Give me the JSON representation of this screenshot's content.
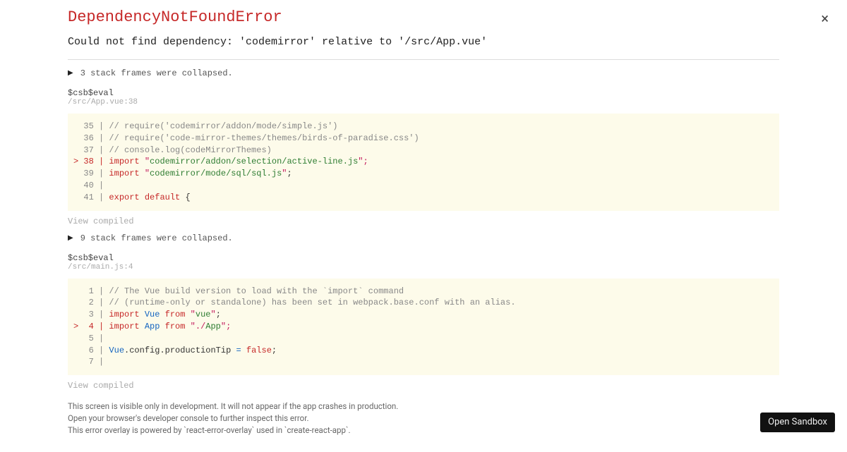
{
  "title": "DependencyNotFoundError",
  "message": "Could not find dependency: 'codemirror' relative to '/src/App.vue'",
  "close_label": "×",
  "frames": [
    {
      "collapsed_label": "3 stack frames were collapsed.",
      "eval": "$csb$eval",
      "path": "/src/App.vue:38",
      "view_compiled": "View compiled"
    },
    {
      "collapsed_label": "9 stack frames were collapsed.",
      "eval": "$csb$eval",
      "path": "/src/main.js:4",
      "view_compiled": "View compiled"
    }
  ],
  "code1": {
    "l35": {
      "g": "  35 | ",
      "c": "// require('codemirror/addon/mode/simple.js')"
    },
    "l36": {
      "g": "  36 | ",
      "c": "// require('code-mirror-themes/themes/birds-of-paradise.css')"
    },
    "l37": {
      "g": "  37 | ",
      "c": "// console.log(codeMirrorThemes)"
    },
    "l38": {
      "g": "> 38 | ",
      "kw": "import",
      "sp": " ",
      "q1": "\"",
      "s": "codemirror/addon/selection/active-line.js",
      "q2": "\"",
      "semi": ";"
    },
    "l39": {
      "g": "  39 | ",
      "kw": "import",
      "sp": " ",
      "q1": "\"",
      "s": "codemirror/mode/sql/sql.js",
      "q2": "\"",
      "semi": ";"
    },
    "l40": {
      "g": "  40 | "
    },
    "l41": {
      "g": "  41 | ",
      "kw1": "export",
      "sp1": " ",
      "kw2": "default",
      "sp2": " ",
      "brace": "{"
    }
  },
  "code2": {
    "l1": {
      "g": "   1 | ",
      "c": "// The Vue build version to load with the `import` command"
    },
    "l2": {
      "g": "   2 | ",
      "c": "// (runtime-only or standalone) has been set in webpack.base.conf with an alias."
    },
    "l3": {
      "g": "   3 | ",
      "kw": "import",
      "sp1": " ",
      "id": "Vue",
      "sp2": " ",
      "from": "from",
      "sp3": " ",
      "q1": "\"",
      "s": "vue",
      "q2": "\"",
      "semi": ";"
    },
    "l4": {
      "g": ">  4 | ",
      "kw": "import",
      "sp1": " ",
      "id": "App",
      "sp2": " ",
      "from": "from",
      "sp3": " ",
      "q1": "\"",
      "dot": "./",
      "s": "App",
      "q2": "\"",
      "semi": ";"
    },
    "l5": {
      "g": "   5 | "
    },
    "l6": {
      "g": "   6 | ",
      "id": "Vue",
      "dot": ".",
      "p1": "config",
      "dot2": ".",
      "p2": "productionTip",
      "sp": " ",
      "eq": "=",
      "sp2": " ",
      "val": "false",
      "semi": ";"
    },
    "l7": {
      "g": "   7 | "
    }
  },
  "footer": {
    "l1": "This screen is visible only in development. It will not appear if the app crashes in production.",
    "l2": "Open your browser's developer console to further inspect this error.",
    "l3": "This error overlay is powered by `react-error-overlay` used in `create-react-app`."
  },
  "open_sandbox": "Open Sandbox"
}
